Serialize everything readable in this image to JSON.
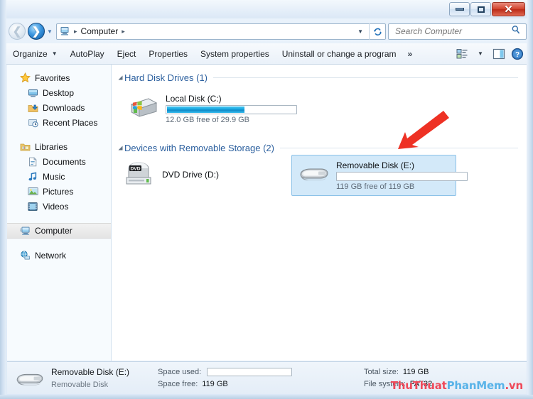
{
  "window": {
    "controls": {
      "minimize": "–",
      "maximize": "□",
      "close": "✕"
    }
  },
  "address_bar": {
    "back_tooltip": "Back",
    "forward_tooltip": "Forward",
    "computer_icon": "computer-icon",
    "breadcrumb": [
      "Computer"
    ],
    "separator": "▸",
    "dropdown": "▼",
    "refresh": "↻"
  },
  "search": {
    "placeholder": "Search Computer",
    "value": "",
    "icon": "search-icon"
  },
  "toolbar": {
    "items": [
      {
        "label": "Organize",
        "caret": "▼"
      },
      {
        "label": "AutoPlay",
        "caret": ""
      },
      {
        "label": "Eject",
        "caret": ""
      },
      {
        "label": "Properties",
        "caret": ""
      },
      {
        "label": "System properties",
        "caret": ""
      },
      {
        "label": "Uninstall or change a program",
        "caret": ""
      }
    ],
    "overflow": "»",
    "view_caret": "▼",
    "icons": [
      "view-options-icon",
      "preview-pane-icon",
      "help-icon"
    ]
  },
  "sidebar": {
    "groups": [
      {
        "header": {
          "label": "Favorites",
          "icon": "star-icon"
        },
        "items": [
          {
            "label": "Desktop",
            "icon": "desktop-icon"
          },
          {
            "label": "Downloads",
            "icon": "downloads-icon"
          },
          {
            "label": "Recent Places",
            "icon": "recent-places-icon"
          }
        ]
      },
      {
        "header": {
          "label": "Libraries",
          "icon": "libraries-icon"
        },
        "items": [
          {
            "label": "Documents",
            "icon": "document-icon"
          },
          {
            "label": "Music",
            "icon": "music-icon"
          },
          {
            "label": "Pictures",
            "icon": "pictures-icon"
          },
          {
            "label": "Videos",
            "icon": "videos-icon"
          }
        ]
      },
      {
        "header": {
          "label": "Computer",
          "icon": "computer-icon",
          "selected": true
        },
        "items": []
      },
      {
        "header": {
          "label": "Network",
          "icon": "network-icon"
        },
        "items": []
      }
    ]
  },
  "content": {
    "groups": [
      {
        "title": "Hard Disk Drives (1)",
        "triangle": "◢",
        "drives": [
          {
            "name": "Local Disk (C:)",
            "icon": "hard-drive-icon",
            "capacity_text": "12.0 GB free of 29.9 GB",
            "used_percent": 60,
            "selected": false,
            "has_meter": true
          }
        ]
      },
      {
        "title": "Devices with Removable Storage (2)",
        "triangle": "◢",
        "drives": [
          {
            "name": "DVD Drive (D:)",
            "icon": "dvd-drive-icon",
            "capacity_text": "",
            "used_percent": 0,
            "selected": false,
            "has_meter": false
          },
          {
            "name": "Removable Disk (E:)",
            "icon": "usb-drive-icon",
            "capacity_text": "119 GB free of 119 GB",
            "used_percent": 0,
            "selected": true,
            "has_meter": true
          }
        ]
      }
    ]
  },
  "details_pane": {
    "icon": "usb-drive-icon",
    "title": "Removable Disk (E:)",
    "subtitle": "Removable Disk",
    "space_used_label": "Space used:",
    "space_used_percent": 0,
    "space_free_label": "Space free:",
    "space_free_value": "119 GB",
    "total_size_label": "Total size:",
    "total_size_value": "119 GB",
    "file_system_label": "File system:",
    "file_system_value": "FAT32"
  },
  "annotation": {
    "arrow": "red-arrow-pointing-to-removable-disk",
    "color": "#ee3124"
  },
  "watermark": {
    "part1": "ThuThuat",
    "part2": "PhanMem",
    "part3": ".vn",
    "color1": "#ef4a5a",
    "color2": "#59b3e8"
  }
}
